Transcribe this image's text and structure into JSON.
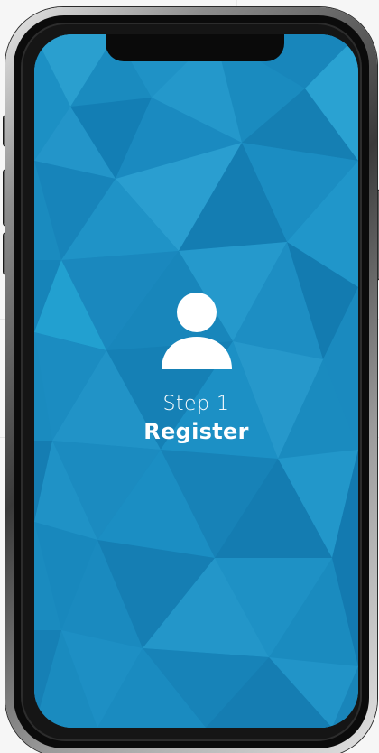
{
  "screen": {
    "step_label": "Step 1",
    "title": "Register",
    "icon": "user-icon"
  },
  "colors": {
    "screen_base": "#1a8bbf",
    "text": "#ffffff"
  }
}
